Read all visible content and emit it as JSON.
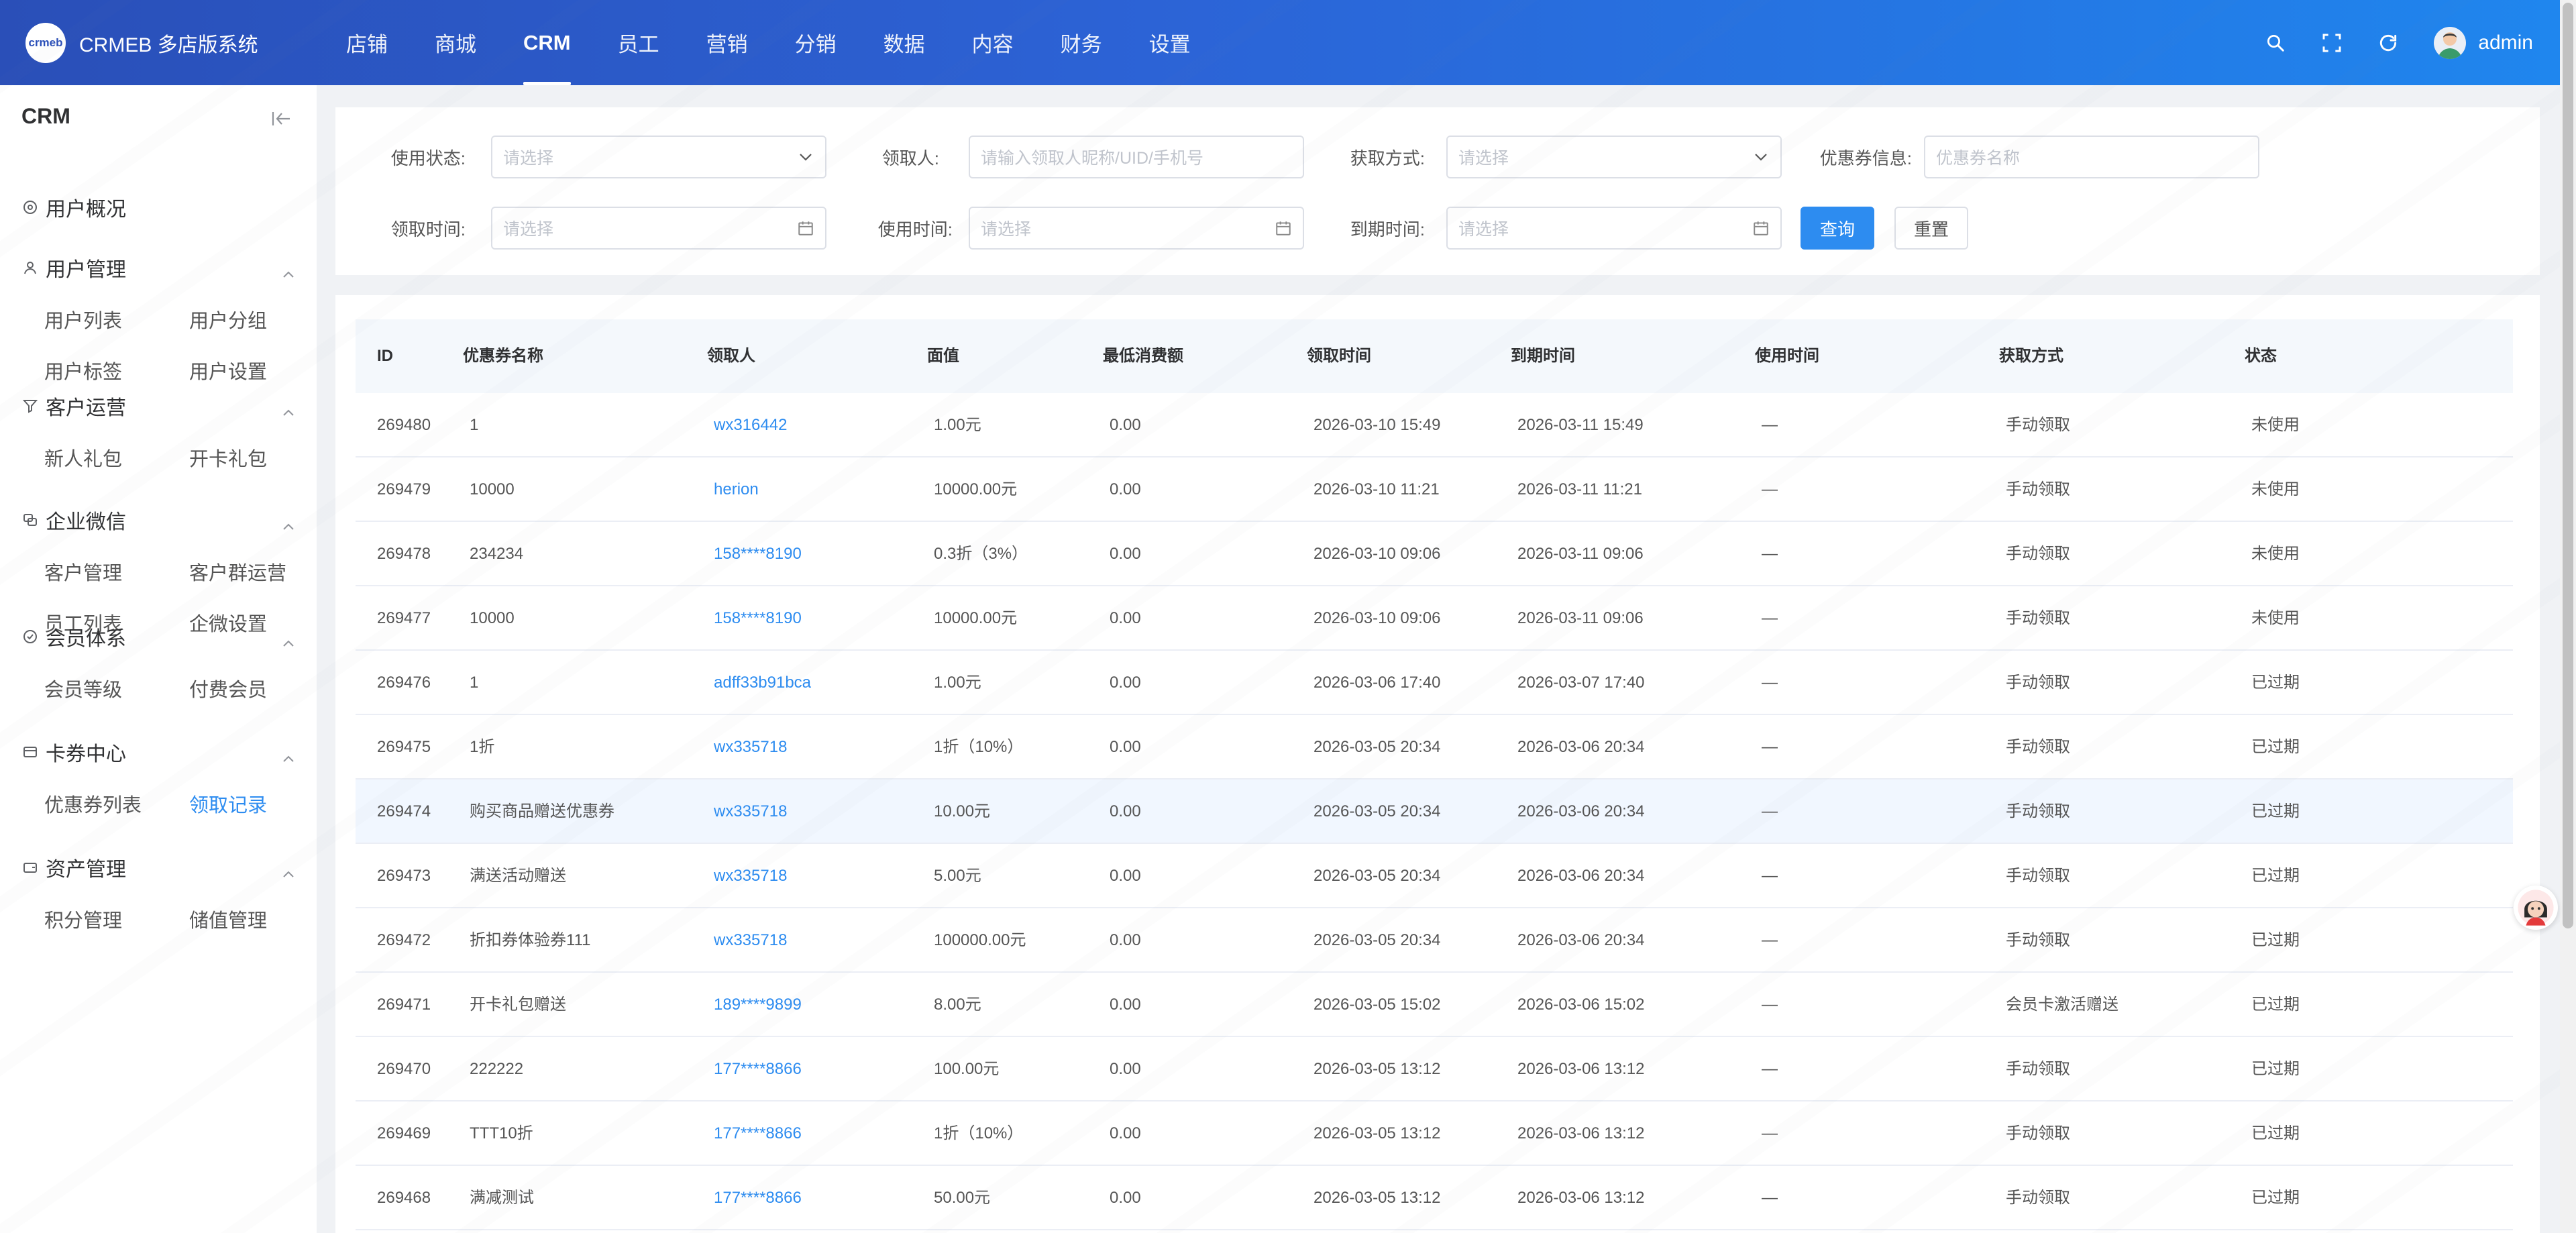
{
  "app": {
    "brand": "CRMEB 多店版系统",
    "logo_text": "crmeb",
    "user": "admin"
  },
  "nav": [
    "店铺",
    "商城",
    "CRM",
    "员工",
    "营销",
    "分销",
    "数据",
    "内容",
    "财务",
    "设置"
  ],
  "nav_active": "CRM",
  "sidebar": {
    "title": "CRM",
    "groups": [
      {
        "label": "用户概况",
        "icon": "dashboard-icon",
        "items": []
      },
      {
        "label": "用户管理",
        "icon": "user-icon",
        "items": [
          "用户列表",
          "用户分组",
          "用户标签",
          "用户设置"
        ]
      },
      {
        "label": "客户运营",
        "icon": "funnel-icon",
        "items": [
          "新人礼包",
          "开卡礼包"
        ]
      },
      {
        "label": "企业微信",
        "icon": "wechat-work-icon",
        "items": [
          "客户管理",
          "客户群运营",
          "员工列表",
          "企微设置"
        ]
      },
      {
        "label": "会员体系",
        "icon": "member-icon",
        "items": [
          "会员等级",
          "付费会员"
        ]
      },
      {
        "label": "卡券中心",
        "icon": "card-icon",
        "items": [
          "优惠券列表",
          "领取记录"
        ]
      },
      {
        "label": "资产管理",
        "icon": "wallet-icon",
        "items": [
          "积分管理",
          "储值管理"
        ]
      }
    ],
    "active_item": "领取记录"
  },
  "filters": {
    "status_label": "使用状态:",
    "status_placeholder": "请选择",
    "receiver_label": "领取人:",
    "receiver_placeholder": "请输入领取人昵称/UID/手机号",
    "method_label": "获取方式:",
    "method_placeholder": "请选择",
    "coupon_label": "优惠券信息:",
    "coupon_placeholder": "优惠券名称",
    "receive_time_label": "领取时间:",
    "receive_time_placeholder": "请选择",
    "use_time_label": "使用时间:",
    "use_time_placeholder": "请选择",
    "expire_time_label": "到期时间:",
    "expire_time_placeholder": "请选择",
    "search_button": "查询",
    "reset_button": "重置"
  },
  "table": {
    "columns": [
      "ID",
      "优惠券名称",
      "领取人",
      "面值",
      "最低消费额",
      "领取时间",
      "到期时间",
      "使用时间",
      "获取方式",
      "状态"
    ],
    "rows": [
      [
        "269480",
        "1",
        "wx316442",
        "1.00元",
        "0.00",
        "2026-03-10 15:49",
        "2026-03-11 15:49",
        "—",
        "手动领取",
        "未使用"
      ],
      [
        "269479",
        "10000",
        "herion",
        "10000.00元",
        "0.00",
        "2026-03-10 11:21",
        "2026-03-11 11:21",
        "—",
        "手动领取",
        "未使用"
      ],
      [
        "269478",
        "234234",
        "158****8190",
        "0.3折（3%）",
        "0.00",
        "2026-03-10 09:06",
        "2026-03-11 09:06",
        "—",
        "手动领取",
        "未使用"
      ],
      [
        "269477",
        "10000",
        "158****8190",
        "10000.00元",
        "0.00",
        "2026-03-10 09:06",
        "2026-03-11 09:06",
        "—",
        "手动领取",
        "未使用"
      ],
      [
        "269476",
        "1",
        "adff33b91bca",
        "1.00元",
        "0.00",
        "2026-03-06 17:40",
        "2026-03-07 17:40",
        "—",
        "手动领取",
        "已过期"
      ],
      [
        "269475",
        "1折",
        "wx335718",
        "1折（10%）",
        "0.00",
        "2026-03-05 20:34",
        "2026-03-06 20:34",
        "—",
        "手动领取",
        "已过期"
      ],
      [
        "269474",
        "购买商品赠送优惠券",
        "wx335718",
        "10.00元",
        "0.00",
        "2026-03-05 20:34",
        "2026-03-06 20:34",
        "—",
        "手动领取",
        "已过期"
      ],
      [
        "269473",
        "满送活动赠送",
        "wx335718",
        "5.00元",
        "0.00",
        "2026-03-05 20:34",
        "2026-03-06 20:34",
        "—",
        "手动领取",
        "已过期"
      ],
      [
        "269472",
        "折扣券体验券111",
        "wx335718",
        "100000.00元",
        "0.00",
        "2026-03-05 20:34",
        "2026-03-06 20:34",
        "—",
        "手动领取",
        "已过期"
      ],
      [
        "269471",
        "开卡礼包赠送",
        "189****9899",
        "8.00元",
        "0.00",
        "2026-03-05 15:02",
        "2026-03-06 15:02",
        "—",
        "会员卡激活赠送",
        "已过期"
      ],
      [
        "269470",
        "222222",
        "177****8866",
        "100.00元",
        "0.00",
        "2026-03-05 13:12",
        "2026-03-06 13:12",
        "—",
        "手动领取",
        "已过期"
      ],
      [
        "269469",
        "TTT10折",
        "177****8866",
        "1折（10%）",
        "0.00",
        "2026-03-05 13:12",
        "2026-03-06 13:12",
        "—",
        "手动领取",
        "已过期"
      ],
      [
        "269468",
        "满减测试",
        "177****8866",
        "50.00元",
        "0.00",
        "2026-03-05 13:12",
        "2026-03-06 13:12",
        "—",
        "手动领取",
        "已过期"
      ]
    ],
    "highlighted_row": "269474"
  },
  "colors": {
    "header_start": "#2a4fb8",
    "header_end": "#1f86ee",
    "primary": "#2d8cf0",
    "link": "#2d8cf0"
  }
}
